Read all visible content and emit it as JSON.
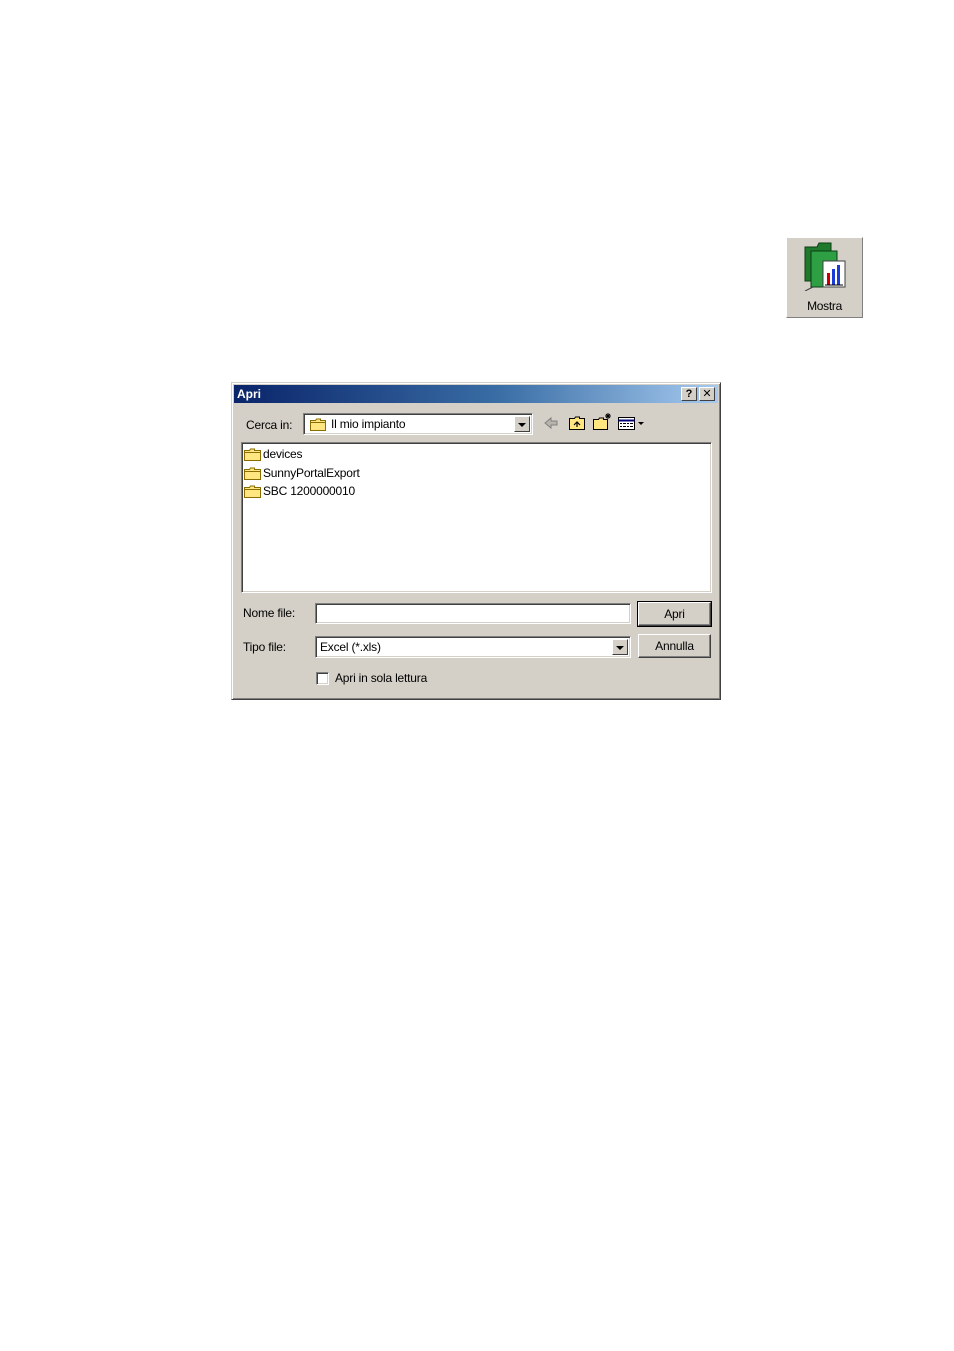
{
  "mostra_button": {
    "label": "Mostra",
    "icon": "folder-with-chart-icon"
  },
  "dialog": {
    "title": "Apri",
    "title_buttons": {
      "help": "?",
      "close": "✕"
    },
    "look_in": {
      "label": "Cerca in:",
      "value": "Il mio impianto"
    },
    "toolbar": [
      {
        "name": "back-icon"
      },
      {
        "name": "up-one-level-icon"
      },
      {
        "name": "new-folder-icon"
      },
      {
        "name": "view-menu-icon"
      }
    ],
    "files": [
      {
        "name": "devices",
        "icon": "folder-icon"
      },
      {
        "name": "SunnyPortalExport",
        "icon": "folder-icon"
      },
      {
        "name": "SBC 1200000010",
        "icon": "folder-icon"
      }
    ],
    "file_name": {
      "label": "Nome file:",
      "value": ""
    },
    "file_type": {
      "label": "Tipo file:",
      "value": "Excel (*.xls)"
    },
    "open_button": "Apri",
    "cancel_button": "Annulla",
    "read_only": {
      "label": "Apri in sola lettura",
      "checked": false
    }
  }
}
